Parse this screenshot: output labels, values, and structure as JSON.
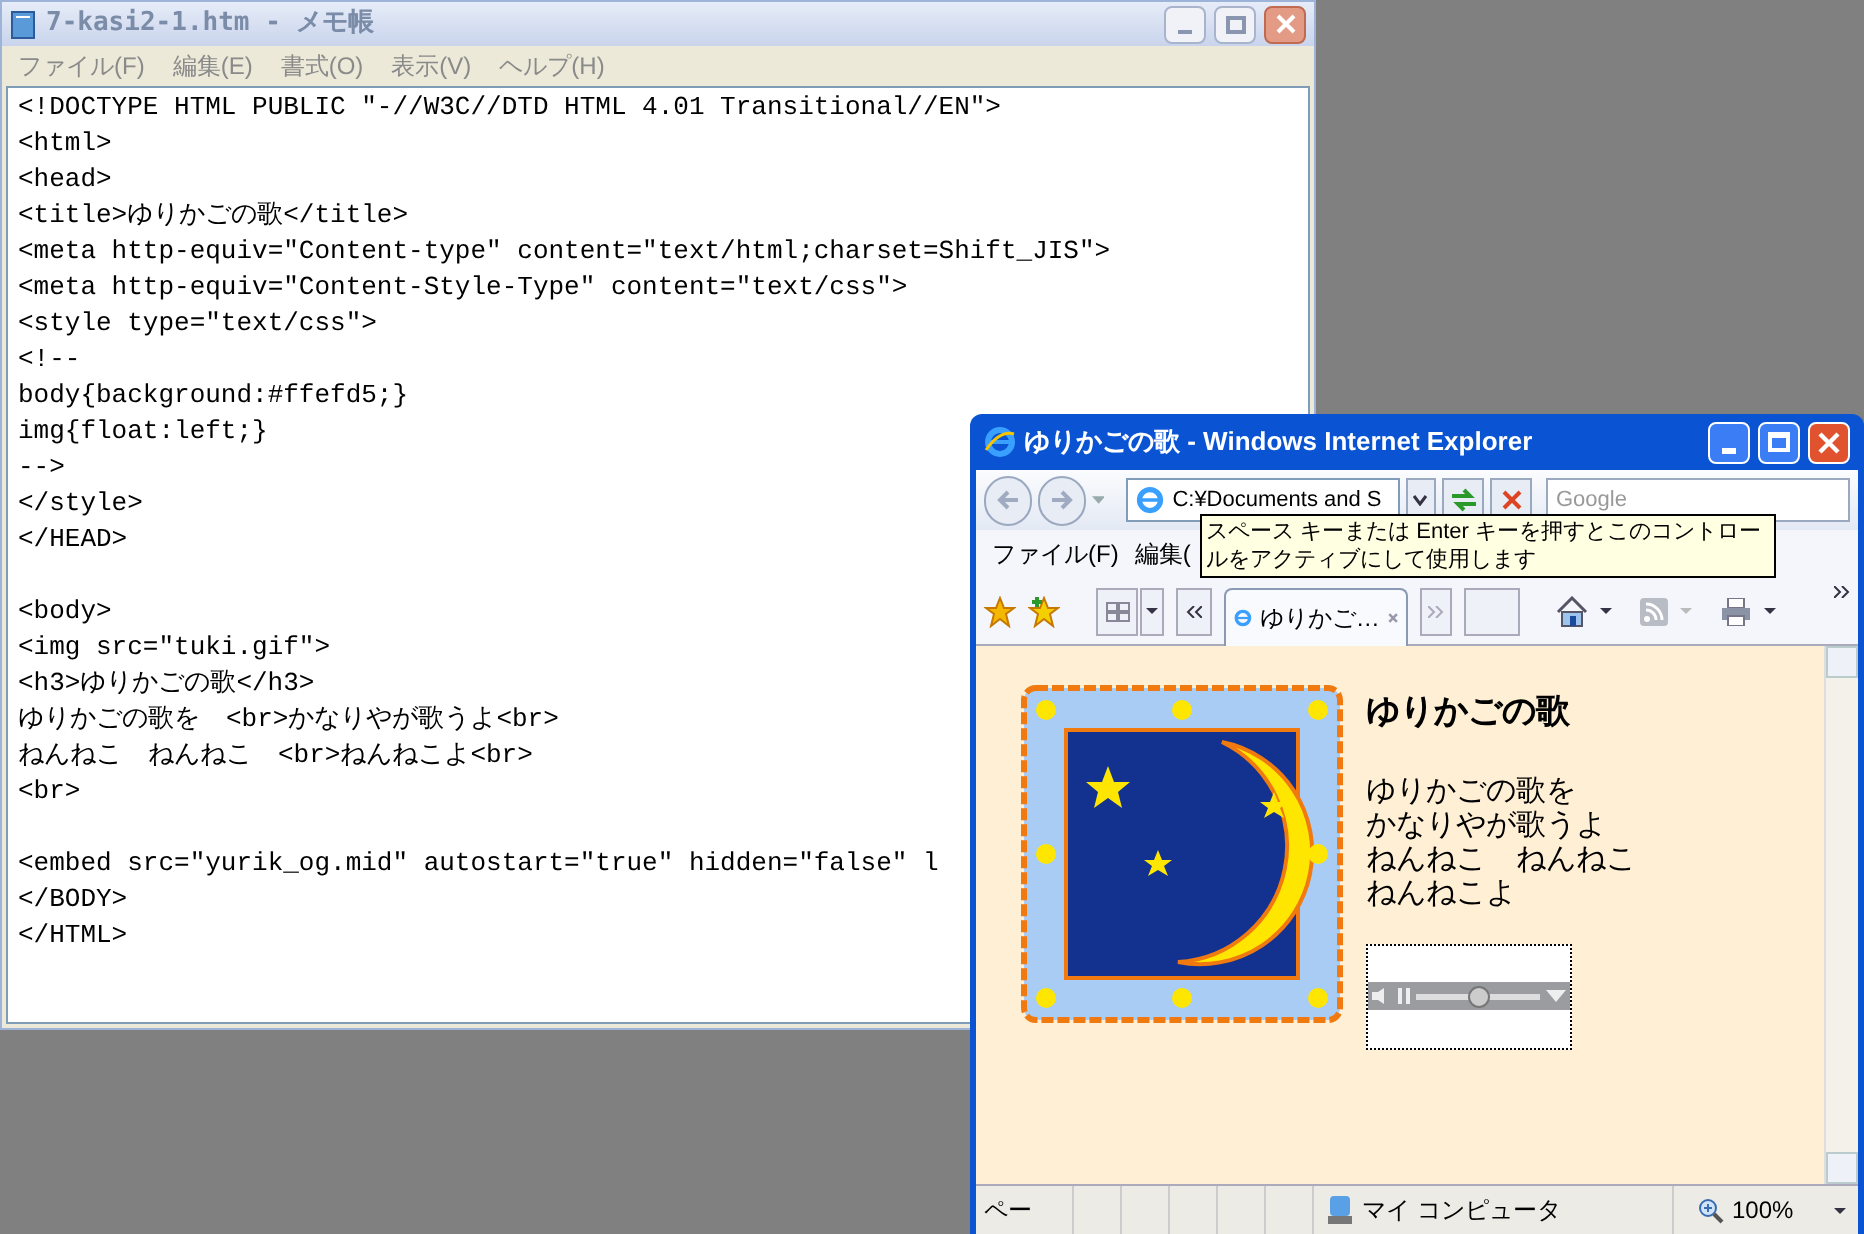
{
  "notepad": {
    "title": "7-kasi2-1.htm - メモ帳",
    "menu": [
      "ファイル(F)",
      "編集(E)",
      "書式(O)",
      "表示(V)",
      "ヘルプ(H)"
    ],
    "blocks": [
      [
        "<!DOCTYPE HTML PUBLIC \"-//W3C//DTD HTML 4.01 Transitional//EN\">",
        "<html>",
        "<head>",
        "<title>ゆりかごの歌</title>",
        "<meta http-equiv=\"Content-type\" content=\"text/html;charset=Shift_JIS\">",
        "<meta http-equiv=\"Content-Style-Type\" content=\"text/css\">",
        "<style type=\"text/css\">",
        "<!--",
        "body{background:#ffefd5;}",
        "img{float:left;}",
        "-->",
        "</style>",
        "</HEAD>"
      ],
      [
        "<body>",
        "<img src=\"tuki.gif\">",
        "<h3>ゆりかごの歌</h3>",
        "ゆりかごの歌を　<br>かなりやが歌うよ<br>",
        "ねんねこ　ねんねこ　<br>ねんねこよ<br>",
        "<br>"
      ],
      [
        "<embed src=\"yurik_og.mid\" autostart=\"true\" hidden=\"false\" l",
        "</BODY>",
        "</HTML>"
      ]
    ]
  },
  "browser": {
    "title": "ゆりかごの歌 - Windows Internet Explorer",
    "address": "C:¥Documents and S",
    "search_placeholder": "Google",
    "tooltip": "スペース キーまたは Enter キーを押すとこのコントロールをアクティブにして使用します",
    "menu": [
      "ファイル(F)",
      "編集("
    ],
    "tabs": [
      {
        "label": "ゆりかご…",
        "selected": true
      }
    ],
    "page": {
      "heading": "ゆりかごの歌",
      "lyrics": [
        "ゆりかごの歌を",
        "かなりやが歌うよ",
        "ねんねこ　ねんねこ",
        "ねんねこよ"
      ],
      "player": {
        "level": 0.5
      }
    },
    "status": {
      "text": "ペー",
      "zone": "マイ コンピュータ",
      "zoom": "100%"
    }
  }
}
